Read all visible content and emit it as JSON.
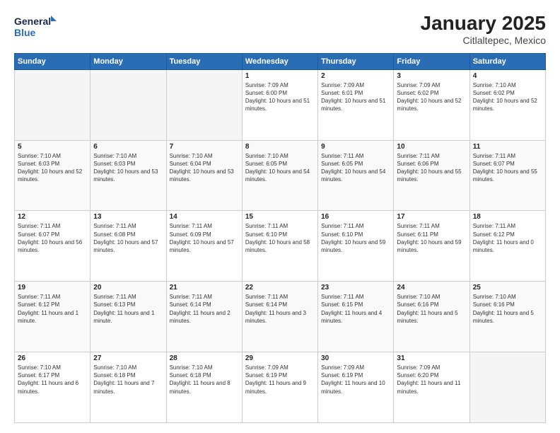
{
  "logo": {
    "line1": "General",
    "line2": "Blue"
  },
  "title": "January 2025",
  "location": "Citlaltepec, Mexico",
  "days_header": [
    "Sunday",
    "Monday",
    "Tuesday",
    "Wednesday",
    "Thursday",
    "Friday",
    "Saturday"
  ],
  "weeks": [
    [
      {
        "day": "",
        "empty": true
      },
      {
        "day": "",
        "empty": true
      },
      {
        "day": "",
        "empty": true
      },
      {
        "day": "1",
        "sunrise": "7:09 AM",
        "sunset": "6:00 PM",
        "daylight": "10 hours and 51 minutes."
      },
      {
        "day": "2",
        "sunrise": "7:09 AM",
        "sunset": "6:01 PM",
        "daylight": "10 hours and 51 minutes."
      },
      {
        "day": "3",
        "sunrise": "7:09 AM",
        "sunset": "6:02 PM",
        "daylight": "10 hours and 52 minutes."
      },
      {
        "day": "4",
        "sunrise": "7:10 AM",
        "sunset": "6:02 PM",
        "daylight": "10 hours and 52 minutes."
      }
    ],
    [
      {
        "day": "5",
        "sunrise": "7:10 AM",
        "sunset": "6:03 PM",
        "daylight": "10 hours and 52 minutes."
      },
      {
        "day": "6",
        "sunrise": "7:10 AM",
        "sunset": "6:03 PM",
        "daylight": "10 hours and 53 minutes."
      },
      {
        "day": "7",
        "sunrise": "7:10 AM",
        "sunset": "6:04 PM",
        "daylight": "10 hours and 53 minutes."
      },
      {
        "day": "8",
        "sunrise": "7:10 AM",
        "sunset": "6:05 PM",
        "daylight": "10 hours and 54 minutes."
      },
      {
        "day": "9",
        "sunrise": "7:11 AM",
        "sunset": "6:05 PM",
        "daylight": "10 hours and 54 minutes."
      },
      {
        "day": "10",
        "sunrise": "7:11 AM",
        "sunset": "6:06 PM",
        "daylight": "10 hours and 55 minutes."
      },
      {
        "day": "11",
        "sunrise": "7:11 AM",
        "sunset": "6:07 PM",
        "daylight": "10 hours and 55 minutes."
      }
    ],
    [
      {
        "day": "12",
        "sunrise": "7:11 AM",
        "sunset": "6:07 PM",
        "daylight": "10 hours and 56 minutes."
      },
      {
        "day": "13",
        "sunrise": "7:11 AM",
        "sunset": "6:08 PM",
        "daylight": "10 hours and 57 minutes."
      },
      {
        "day": "14",
        "sunrise": "7:11 AM",
        "sunset": "6:09 PM",
        "daylight": "10 hours and 57 minutes."
      },
      {
        "day": "15",
        "sunrise": "7:11 AM",
        "sunset": "6:10 PM",
        "daylight": "10 hours and 58 minutes."
      },
      {
        "day": "16",
        "sunrise": "7:11 AM",
        "sunset": "6:10 PM",
        "daylight": "10 hours and 59 minutes."
      },
      {
        "day": "17",
        "sunrise": "7:11 AM",
        "sunset": "6:11 PM",
        "daylight": "10 hours and 59 minutes."
      },
      {
        "day": "18",
        "sunrise": "7:11 AM",
        "sunset": "6:12 PM",
        "daylight": "11 hours and 0 minutes."
      }
    ],
    [
      {
        "day": "19",
        "sunrise": "7:11 AM",
        "sunset": "6:12 PM",
        "daylight": "11 hours and 1 minute."
      },
      {
        "day": "20",
        "sunrise": "7:11 AM",
        "sunset": "6:13 PM",
        "daylight": "11 hours and 1 minute."
      },
      {
        "day": "21",
        "sunrise": "7:11 AM",
        "sunset": "6:14 PM",
        "daylight": "11 hours and 2 minutes."
      },
      {
        "day": "22",
        "sunrise": "7:11 AM",
        "sunset": "6:14 PM",
        "daylight": "11 hours and 3 minutes."
      },
      {
        "day": "23",
        "sunrise": "7:11 AM",
        "sunset": "6:15 PM",
        "daylight": "11 hours and 4 minutes."
      },
      {
        "day": "24",
        "sunrise": "7:10 AM",
        "sunset": "6:16 PM",
        "daylight": "11 hours and 5 minutes."
      },
      {
        "day": "25",
        "sunrise": "7:10 AM",
        "sunset": "6:16 PM",
        "daylight": "11 hours and 5 minutes."
      }
    ],
    [
      {
        "day": "26",
        "sunrise": "7:10 AM",
        "sunset": "6:17 PM",
        "daylight": "11 hours and 6 minutes."
      },
      {
        "day": "27",
        "sunrise": "7:10 AM",
        "sunset": "6:18 PM",
        "daylight": "11 hours and 7 minutes."
      },
      {
        "day": "28",
        "sunrise": "7:10 AM",
        "sunset": "6:18 PM",
        "daylight": "11 hours and 8 minutes."
      },
      {
        "day": "29",
        "sunrise": "7:09 AM",
        "sunset": "6:19 PM",
        "daylight": "11 hours and 9 minutes."
      },
      {
        "day": "30",
        "sunrise": "7:09 AM",
        "sunset": "6:19 PM",
        "daylight": "11 hours and 10 minutes."
      },
      {
        "day": "31",
        "sunrise": "7:09 AM",
        "sunset": "6:20 PM",
        "daylight": "11 hours and 11 minutes."
      },
      {
        "day": "",
        "empty": true
      }
    ]
  ],
  "labels": {
    "sunrise_prefix": "Sunrise: ",
    "sunset_prefix": "Sunset: ",
    "daylight_prefix": "Daylight: "
  }
}
